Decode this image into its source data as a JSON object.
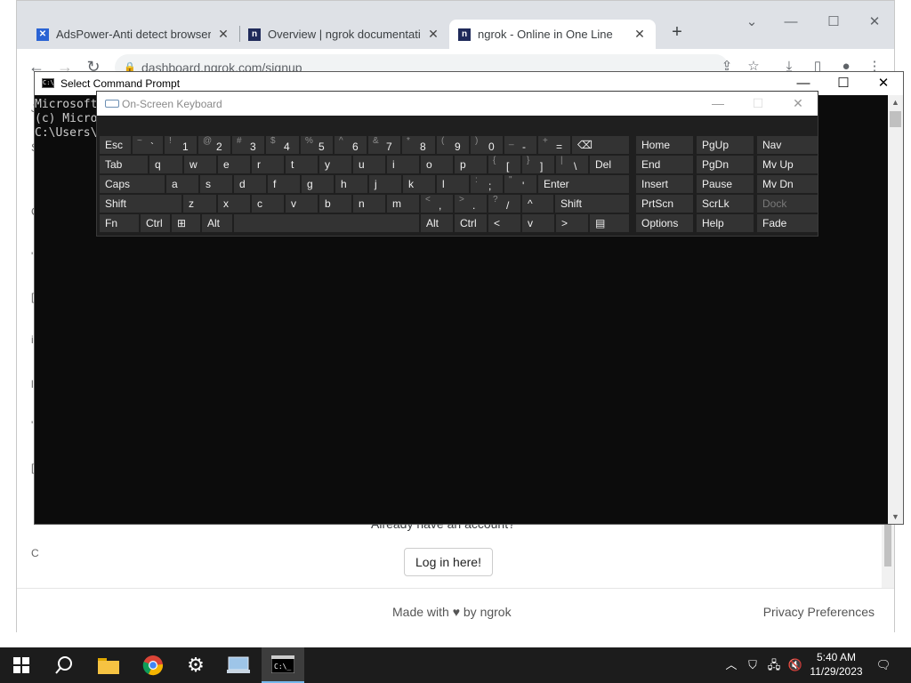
{
  "browser": {
    "tabs": [
      {
        "title": "AdsPower-Anti detect browser f",
        "favicon": "adspower-icon",
        "active": false
      },
      {
        "title": "Overview | ngrok documentatio",
        "favicon": "ngrok-docs-icon",
        "active": false
      },
      {
        "title": "ngrok - Online in One Line",
        "favicon": "ngrok-icon",
        "active": true
      }
    ],
    "url": "dashboard.ngrok.com/signup",
    "page": {
      "already_text": "Already have an account?",
      "login_button": "Log in here!",
      "footer_made": "Made with ♥ by ngrok",
      "footer_privacy": "Privacy Preferences"
    }
  },
  "cmd": {
    "title": "Select Command Prompt",
    "lines": [
      "Microsoft",
      "(c) Micro",
      "",
      "C:\\Users\\"
    ]
  },
  "osk": {
    "title": "On-Screen Keyboard",
    "rows": [
      [
        {
          "label": "Esc"
        },
        {
          "top": "~",
          "main": "`"
        },
        {
          "top": "!",
          "main": "1"
        },
        {
          "top": "@",
          "main": "2"
        },
        {
          "top": "#",
          "main": "3"
        },
        {
          "top": "$",
          "main": "4"
        },
        {
          "top": "%",
          "main": "5"
        },
        {
          "top": "^",
          "main": "6"
        },
        {
          "top": "&",
          "main": "7"
        },
        {
          "top": "*",
          "main": "8"
        },
        {
          "top": "(",
          "main": "9"
        },
        {
          "top": ")",
          "main": "0"
        },
        {
          "top": "_",
          "main": "-"
        },
        {
          "top": "+",
          "main": "="
        },
        {
          "label": "⌫"
        }
      ],
      [
        {
          "label": "Tab"
        },
        {
          "label": "q"
        },
        {
          "label": "w"
        },
        {
          "label": "e"
        },
        {
          "label": "r"
        },
        {
          "label": "t"
        },
        {
          "label": "y"
        },
        {
          "label": "u"
        },
        {
          "label": "i"
        },
        {
          "label": "o"
        },
        {
          "label": "p"
        },
        {
          "top": "{",
          "main": "["
        },
        {
          "top": "}",
          "main": "]"
        },
        {
          "top": "|",
          "main": "\\"
        },
        {
          "label": "Del"
        }
      ],
      [
        {
          "label": "Caps"
        },
        {
          "label": "a"
        },
        {
          "label": "s"
        },
        {
          "label": "d"
        },
        {
          "label": "f"
        },
        {
          "label": "g"
        },
        {
          "label": "h"
        },
        {
          "label": "j"
        },
        {
          "label": "k"
        },
        {
          "label": "l"
        },
        {
          "top": ":",
          "main": ";"
        },
        {
          "top": "\"",
          "main": "'"
        },
        {
          "label": "Enter"
        }
      ],
      [
        {
          "label": "Shift"
        },
        {
          "label": "z"
        },
        {
          "label": "x"
        },
        {
          "label": "c"
        },
        {
          "label": "v"
        },
        {
          "label": "b"
        },
        {
          "label": "n"
        },
        {
          "label": "m"
        },
        {
          "top": "<",
          "main": ","
        },
        {
          "top": ">",
          "main": "."
        },
        {
          "top": "?",
          "main": "/"
        },
        {
          "label": "^"
        },
        {
          "label": "Shift"
        }
      ],
      [
        {
          "label": "Fn"
        },
        {
          "label": "Ctrl"
        },
        {
          "label": "⊞"
        },
        {
          "label": "Alt"
        },
        {
          "label": ""
        },
        {
          "label": "Alt"
        },
        {
          "label": "Ctrl"
        },
        {
          "label": "<"
        },
        {
          "label": "v"
        },
        {
          "label": ">"
        },
        {
          "label": "▤"
        }
      ]
    ],
    "nav_rows": [
      [
        "Home",
        "PgUp",
        "Nav"
      ],
      [
        "End",
        "PgDn",
        "Mv Up"
      ],
      [
        "Insert",
        "Pause",
        "Mv Dn"
      ],
      [
        "PrtScn",
        "ScrLk",
        "Dock"
      ],
      [
        "Options",
        "Help",
        "Fade"
      ]
    ]
  },
  "taskbar": {
    "time": "5:40 AM",
    "date": "11/29/2023",
    "items": [
      "start-icon",
      "search-icon",
      "file-explorer-icon",
      "chrome-icon",
      "settings-icon",
      "network-app-icon",
      "command-prompt-icon"
    ]
  }
}
